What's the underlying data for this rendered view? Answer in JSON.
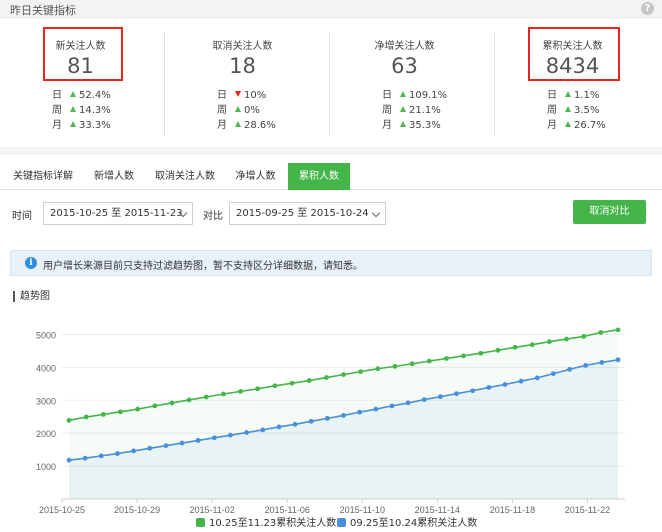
{
  "header": {
    "title": "昨日关键指标",
    "help_glyph": "?"
  },
  "stats": [
    {
      "label": "新关注人数",
      "value": "81",
      "highlighted": true,
      "changes": [
        {
          "period": "日",
          "dir": "up",
          "pct": "52.4%"
        },
        {
          "period": "周",
          "dir": "up",
          "pct": "14.3%"
        },
        {
          "period": "月",
          "dir": "up",
          "pct": "33.3%"
        }
      ]
    },
    {
      "label": "取消关注人数",
      "value": "18",
      "highlighted": false,
      "changes": [
        {
          "period": "日",
          "dir": "down",
          "pct": "10%"
        },
        {
          "period": "周",
          "dir": "up",
          "pct": "0%"
        },
        {
          "period": "月",
          "dir": "up",
          "pct": "28.6%"
        }
      ]
    },
    {
      "label": "净增关注人数",
      "value": "63",
      "highlighted": false,
      "changes": [
        {
          "period": "日",
          "dir": "up",
          "pct": "109.1%"
        },
        {
          "period": "周",
          "dir": "up",
          "pct": "21.1%"
        },
        {
          "period": "月",
          "dir": "up",
          "pct": "35.3%"
        }
      ]
    },
    {
      "label": "累积关注人数",
      "value": "8434",
      "highlighted": true,
      "changes": [
        {
          "period": "日",
          "dir": "up",
          "pct": "1.1%"
        },
        {
          "period": "周",
          "dir": "up",
          "pct": "3.5%"
        },
        {
          "period": "月",
          "dir": "up",
          "pct": "26.7%"
        }
      ]
    }
  ],
  "tabs": [
    {
      "label": "关键指标详解",
      "active": false
    },
    {
      "label": "新增人数",
      "active": false
    },
    {
      "label": "取消关注人数",
      "active": false
    },
    {
      "label": "净增人数",
      "active": false
    },
    {
      "label": "累积人数",
      "active": true
    }
  ],
  "filter": {
    "time_label": "时间",
    "range": "2015-10-25 至 2015-11-23",
    "compare_label": "对比",
    "compare_range": "2015-09-25 至 2015-10-24",
    "cancel_compare": "取消对比"
  },
  "notice": {
    "icon": "info-icon",
    "text": "用户增长来源目前只支持过滤趋势图，暂不支持区分详细数据，请知悉。"
  },
  "section_title": "趋势图",
  "colors": {
    "green": "#44b549",
    "blue": "#4a8fd8",
    "red": "#e8251f"
  },
  "chart_data": {
    "type": "line",
    "title": "",
    "xlabel": "",
    "ylabel": "",
    "ylim": [
      0,
      5500
    ],
    "yticks": [
      1000,
      2000,
      3000,
      4000,
      5000
    ],
    "x_tick_labels": [
      "2015-10-25",
      "2015-10-29",
      "2015-11-02",
      "2015-11-06",
      "2015-11-10",
      "2015-11-14",
      "2015-11-18",
      "2015-11-22"
    ],
    "grid": true,
    "legend_position": "bottom",
    "series": [
      {
        "name": "10.25至11.23累积关注人数",
        "color": "#44b549",
        "values": [
          2390,
          2490,
          2570,
          2650,
          2730,
          2830,
          2920,
          3010,
          3100,
          3190,
          3270,
          3350,
          3440,
          3520,
          3600,
          3690,
          3780,
          3870,
          3960,
          4030,
          4110,
          4190,
          4270,
          4350,
          4430,
          4520,
          4610,
          4690,
          4780,
          4860,
          4940,
          5060,
          5140
        ]
      },
      {
        "name": "09.25至10.24累积关注人数",
        "color": "#4a8fd8",
        "values": [
          1180,
          1240,
          1310,
          1380,
          1460,
          1540,
          1620,
          1700,
          1780,
          1860,
          1940,
          2020,
          2100,
          2190,
          2270,
          2360,
          2450,
          2540,
          2640,
          2730,
          2830,
          2920,
          3020,
          3110,
          3200,
          3290,
          3390,
          3480,
          3580,
          3680,
          3810,
          3940,
          4060,
          4150,
          4230
        ]
      }
    ]
  }
}
